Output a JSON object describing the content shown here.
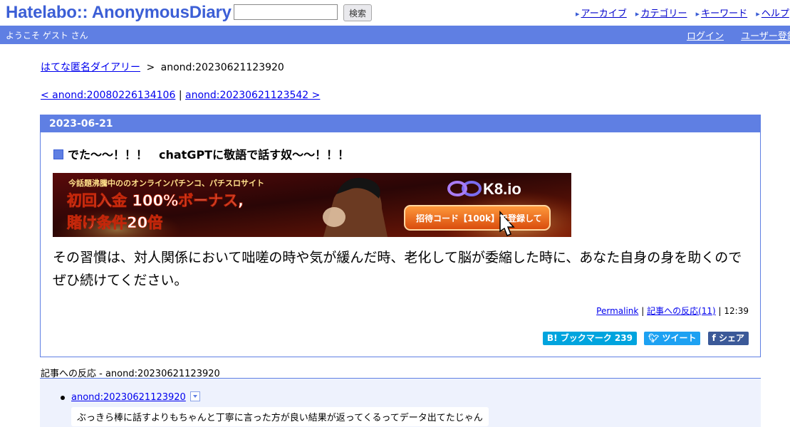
{
  "header": {
    "logo": "Hatelabo:: AnonymousDiary",
    "search_placeholder": "",
    "search_button": "検索",
    "nav": [
      "アーカイブ",
      "カテゴリー",
      "キーワード",
      "ヘルプ"
    ]
  },
  "userbar": {
    "welcome": "ようこそ ゲスト さん",
    "login": "ログイン",
    "register": "ユーザー登録"
  },
  "breadcrumb": {
    "home": "はてな匿名ダイアリー",
    "separator": ">",
    "current": "anond:20230621123920"
  },
  "pager": {
    "prev": "< anond:20080226134106",
    "separator": "|",
    "next": "anond:20230621123542 >"
  },
  "entry": {
    "date": "2023-06-21",
    "title": "でた〜〜！！！　chatGPTに敬語で話す奴〜〜！！！",
    "banner": {
      "headline": "今話題沸騰中ののオンラインパチンコ、パチスロサイト",
      "line1": "初回入金 100%ボーナス,",
      "line2": "賭け条件20倍",
      "brand": "K8.io",
      "cta": "招待コード【100k】で登録して"
    },
    "body": "その習慣は、対人関係において咄嗟の時や気が緩んだ時、老化して脳が委縮した時に、あなた自身の身を助くのでぜひ続けてください。",
    "permalink": "Permalink",
    "meta_sep": "|",
    "reactions_link": "記事への反応(11)",
    "time": "12:39",
    "bookmark": "B! ブックマーク 239",
    "tweet": "ツイート",
    "share": "シェア"
  },
  "reactions": {
    "title": "記事への反応 - anond:20230621123920",
    "items": [
      {
        "link": "anond:20230621123920",
        "text": "ぶっきら棒に話すよりもちゃんと丁寧に言った方が良い結果が返ってくるってデータ出てたじゃん"
      }
    ]
  },
  "colors": {
    "accent": "#5f7fe3",
    "logo": "#3c5fd6",
    "link": "#0000ee",
    "reaction_bg": "#eef2fd"
  }
}
